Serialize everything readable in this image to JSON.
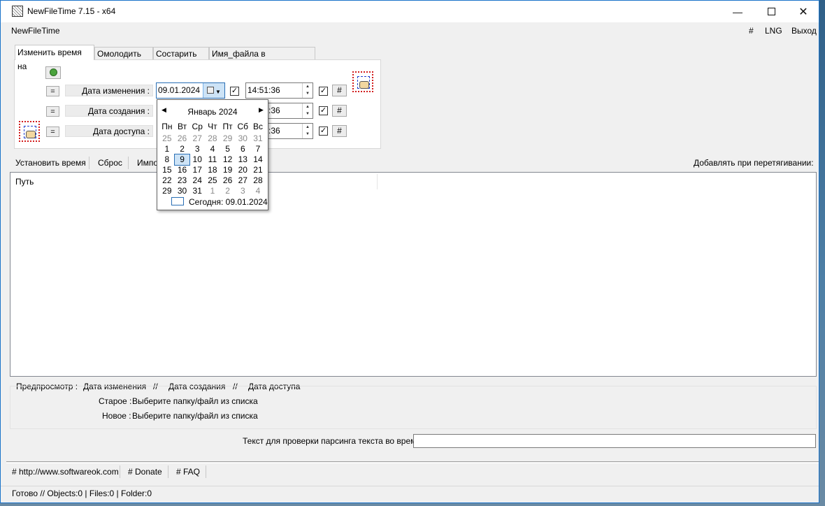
{
  "window": {
    "title": "NewFileTime 7.15 - x64"
  },
  "menu": {
    "app": "NewFileTime",
    "hash": "#",
    "lng": "LNG",
    "exit": "Выход"
  },
  "tabs": [
    {
      "label": "Изменить время на",
      "active": true
    },
    {
      "label": "Омолодить на",
      "active": false
    },
    {
      "label": "Состарить на",
      "active": false
    },
    {
      "label": "Имя_файла в время_файла",
      "active": false
    }
  ],
  "rows": [
    {
      "eq": "=",
      "label": "Дата изменения :",
      "date": "09.01.2024",
      "time": "14:51:36",
      "checked": true,
      "hash": "#"
    },
    {
      "eq": "=",
      "label": "Дата создания :",
      "time": ":36",
      "checked": true,
      "hash": "#"
    },
    {
      "eq": "=",
      "label": "Дата доступа :",
      "time": ":36",
      "checked": true,
      "hash": "#"
    }
  ],
  "toolbar": {
    "set_time": "Установить время",
    "reset": "Сброс",
    "import": "Импо",
    "drag_option": "Добавлять при перетягивании:"
  },
  "list": {
    "col_path": "Путь"
  },
  "calendar": {
    "month_label": "Январь 2024",
    "weekdays": [
      "Пн",
      "Вт",
      "Ср",
      "Чт",
      "Пт",
      "Сб",
      "Вс"
    ],
    "weeks": [
      [
        "25",
        "26",
        "27",
        "28",
        "29",
        "30",
        "31"
      ],
      [
        "1",
        "2",
        "3",
        "4",
        "5",
        "6",
        "7"
      ],
      [
        "8",
        "9",
        "10",
        "11",
        "12",
        "13",
        "14"
      ],
      [
        "15",
        "16",
        "17",
        "18",
        "19",
        "20",
        "21"
      ],
      [
        "22",
        "23",
        "24",
        "25",
        "26",
        "27",
        "28"
      ],
      [
        "29",
        "30",
        "31",
        "1",
        "2",
        "3",
        "4"
      ]
    ],
    "selected_day": "9",
    "today_label": "Сегодня: 09.01.2024"
  },
  "preview": {
    "label": "Предпросмотр :",
    "c1": "Дата изменения",
    "s1": "//",
    "c2": "Дата создания",
    "s2": "//",
    "c3": "Дата доступа",
    "old_label": "Старое :",
    "old_value": "Выберите папку/файл из списка",
    "new_label": "Новое :",
    "new_value": "Выберите папку/файл из списка"
  },
  "parse": {
    "label": "Текст для проверки парсинга текста во время",
    "value": ""
  },
  "links": {
    "website": "# http://www.softwareok.com",
    "donate": "# Donate",
    "faq": "# FAQ"
  },
  "status": {
    "text": "Готово // Objects:0 | Files:0  | Folder:0"
  }
}
